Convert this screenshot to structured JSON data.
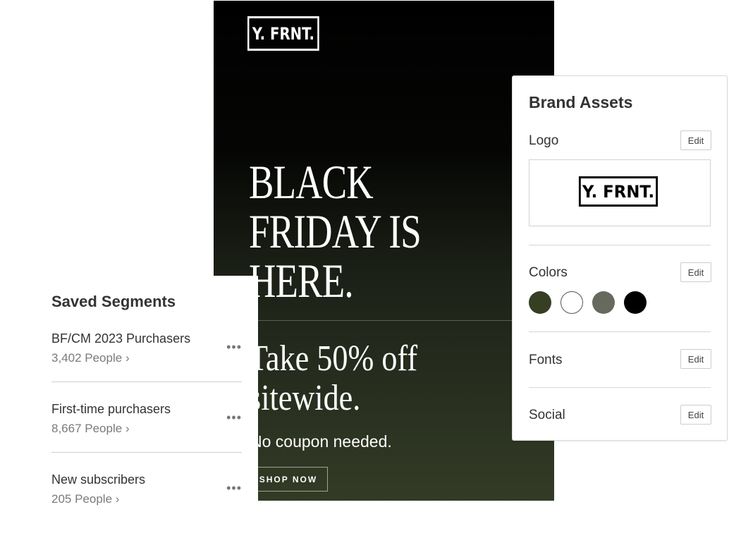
{
  "email": {
    "logo": "Y. FRNT.",
    "headline": [
      "BLACK",
      "FRIDAY IS",
      "HERE."
    ],
    "subhead": [
      "Take 50% off",
      "sitewide."
    ],
    "body": "No coupon needed.",
    "cta": "SHOP NOW",
    "gradient_colors": [
      "#000000",
      "#333b26"
    ]
  },
  "segments": {
    "title": "Saved Segments",
    "items": [
      {
        "name": "BF/CM 2023 Purchasers",
        "count": "3,402 People",
        "more": "•••"
      },
      {
        "name": "First-time purchasers",
        "count": "8,667 People",
        "more": "•••"
      },
      {
        "name": "New subscribers",
        "count": "205 People",
        "more": "•••"
      }
    ],
    "chevron": "›"
  },
  "brand": {
    "title": "Brand Assets",
    "logo_label": "Logo",
    "logo_text": "Y. FRNT.",
    "colors_label": "Colors",
    "fonts_label": "Fonts",
    "social_label": "Social",
    "edit_label": "Edit",
    "swatches": [
      "#363f23",
      "#ffffff",
      "#666a5e",
      "#000000"
    ]
  }
}
